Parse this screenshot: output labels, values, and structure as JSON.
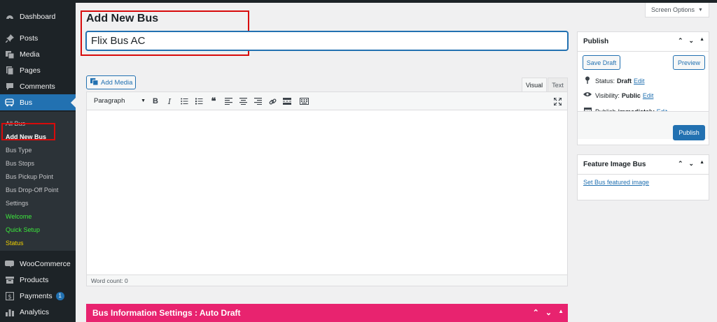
{
  "sidebar": {
    "items": [
      {
        "label": "Dashboard",
        "icon": "dashboard-icon"
      },
      {
        "label": "Posts",
        "icon": "pin-icon"
      },
      {
        "label": "Media",
        "icon": "media-icon"
      },
      {
        "label": "Pages",
        "icon": "pages-icon"
      },
      {
        "label": "Comments",
        "icon": "comment-icon"
      },
      {
        "label": "Bus",
        "icon": "bus-icon"
      },
      {
        "label": "WooCommerce",
        "icon": "woocommerce-icon"
      },
      {
        "label": "Products",
        "icon": "archive-icon"
      },
      {
        "label": "Payments",
        "icon": "dollar-icon",
        "badge": "1"
      },
      {
        "label": "Analytics",
        "icon": "bar-chart-icon"
      }
    ],
    "submenu": [
      "All Bus",
      "Add New Bus",
      "Bus Type",
      "Bus Stops",
      "Bus Pickup Point",
      "Bus Drop-Off Point",
      "Settings",
      "Welcome",
      "Quick Setup",
      "Status"
    ]
  },
  "screen_options": "Screen Options",
  "page": {
    "title": "Add New Bus",
    "post_title_value": "Flix Bus AC"
  },
  "editor": {
    "add_media": "Add Media",
    "tab_visual": "Visual",
    "tab_text": "Text",
    "format_select": "Paragraph",
    "word_count": "Word count: 0"
  },
  "info_bar": {
    "title": "Bus Information Settings : Auto Draft"
  },
  "publish_box": {
    "title": "Publish",
    "save_draft": "Save Draft",
    "preview": "Preview",
    "status_label": "Status:",
    "status_value": "Draft",
    "visibility_label": "Visibility:",
    "visibility_value": "Public",
    "publish_label": "Publish",
    "publish_value": "immediately",
    "edit": "Edit",
    "publish_button": "Publish"
  },
  "feature_box": {
    "title": "Feature Image Bus",
    "link": "Set Bus featured image"
  },
  "colors": {
    "accent": "#2271b1",
    "sidebar": "#1d2327",
    "highlight": "#d80b0b",
    "info_bar": "#e8236f"
  }
}
